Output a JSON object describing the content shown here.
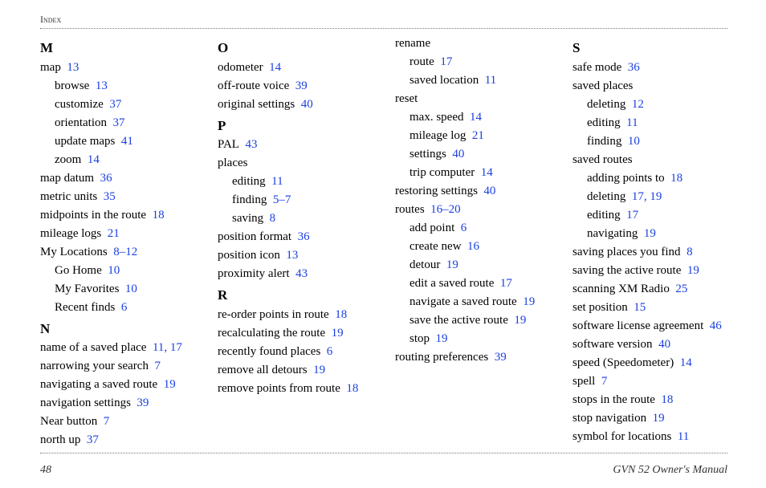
{
  "header": {
    "running_head": "Index"
  },
  "footer": {
    "page_number": "48",
    "doc_title": "GVN 52 Owner's Manual"
  },
  "link_color": "#1a3fe0",
  "columns": [
    [
      {
        "type": "letter",
        "text": "M"
      },
      {
        "type": "entry",
        "level": 0,
        "term": "map",
        "pages": "13"
      },
      {
        "type": "entry",
        "level": 1,
        "term": "browse",
        "pages": "13"
      },
      {
        "type": "entry",
        "level": 1,
        "term": "customize",
        "pages": "37"
      },
      {
        "type": "entry",
        "level": 1,
        "term": "orientation",
        "pages": "37"
      },
      {
        "type": "entry",
        "level": 1,
        "term": "update maps",
        "pages": "41"
      },
      {
        "type": "entry",
        "level": 1,
        "term": "zoom",
        "pages": "14"
      },
      {
        "type": "entry",
        "level": 0,
        "term": "map datum",
        "pages": "36"
      },
      {
        "type": "entry",
        "level": 0,
        "term": "metric units",
        "pages": "35"
      },
      {
        "type": "entry",
        "level": 0,
        "term": "midpoints in the route",
        "pages": "18"
      },
      {
        "type": "entry",
        "level": 0,
        "term": "mileage logs",
        "pages": "21"
      },
      {
        "type": "entry",
        "level": 0,
        "term": "My Locations",
        "pages": "8–12"
      },
      {
        "type": "entry",
        "level": 1,
        "term": "Go Home",
        "pages": "10"
      },
      {
        "type": "entry",
        "level": 1,
        "term": "My Favorites",
        "pages": "10"
      },
      {
        "type": "entry",
        "level": 1,
        "term": "Recent finds",
        "pages": "6"
      },
      {
        "type": "letter",
        "text": "N"
      },
      {
        "type": "entry",
        "level": 0,
        "term": "name of a saved place",
        "pages": "11, 17"
      },
      {
        "type": "entry",
        "level": 0,
        "term": "narrowing your search",
        "pages": "7"
      },
      {
        "type": "entry",
        "level": 0,
        "term": "navigating a saved route",
        "pages": "19"
      },
      {
        "type": "entry",
        "level": 0,
        "term": "navigation settings",
        "pages": "39"
      },
      {
        "type": "entry",
        "level": 0,
        "term": "Near button",
        "pages": "7"
      },
      {
        "type": "entry",
        "level": 0,
        "term": "north up",
        "pages": "37"
      }
    ],
    [
      {
        "type": "letter",
        "text": "O"
      },
      {
        "type": "entry",
        "level": 0,
        "term": "odometer",
        "pages": "14"
      },
      {
        "type": "entry",
        "level": 0,
        "term": "off-route voice",
        "pages": "39"
      },
      {
        "type": "entry",
        "level": 0,
        "term": "original settings",
        "pages": "40"
      },
      {
        "type": "letter",
        "text": "P"
      },
      {
        "type": "entry",
        "level": 0,
        "term": "PAL",
        "pages": "43"
      },
      {
        "type": "entry",
        "level": 0,
        "term": "places",
        "pages": ""
      },
      {
        "type": "entry",
        "level": 1,
        "term": "editing",
        "pages": "11"
      },
      {
        "type": "entry",
        "level": 1,
        "term": "finding",
        "pages": "5–7"
      },
      {
        "type": "entry",
        "level": 1,
        "term": "saving",
        "pages": "8"
      },
      {
        "type": "entry",
        "level": 0,
        "term": "position format",
        "pages": "36"
      },
      {
        "type": "entry",
        "level": 0,
        "term": "position icon",
        "pages": "13"
      },
      {
        "type": "entry",
        "level": 0,
        "term": "proximity alert",
        "pages": "43"
      },
      {
        "type": "letter",
        "text": "R"
      },
      {
        "type": "entry",
        "level": 0,
        "term": "re-order points in route",
        "pages": "18"
      },
      {
        "type": "entry",
        "level": 0,
        "term": "recalculating the route",
        "pages": "19"
      },
      {
        "type": "entry",
        "level": 0,
        "term": "recently found places",
        "pages": "6"
      },
      {
        "type": "entry",
        "level": 0,
        "term": "remove all detours",
        "pages": "19"
      },
      {
        "type": "entry",
        "level": 0,
        "term": "remove points from route",
        "pages": "18"
      }
    ],
    [
      {
        "type": "entry",
        "level": 0,
        "term": "rename",
        "pages": ""
      },
      {
        "type": "entry",
        "level": 1,
        "term": "route",
        "pages": "17"
      },
      {
        "type": "entry",
        "level": 1,
        "term": "saved location",
        "pages": "11"
      },
      {
        "type": "entry",
        "level": 0,
        "term": "reset",
        "pages": ""
      },
      {
        "type": "entry",
        "level": 1,
        "term": "max. speed",
        "pages": "14"
      },
      {
        "type": "entry",
        "level": 1,
        "term": "mileage log",
        "pages": "21"
      },
      {
        "type": "entry",
        "level": 1,
        "term": "settings",
        "pages": "40"
      },
      {
        "type": "entry",
        "level": 1,
        "term": "trip computer",
        "pages": "14"
      },
      {
        "type": "entry",
        "level": 0,
        "term": "restoring settings",
        "pages": "40"
      },
      {
        "type": "entry",
        "level": 0,
        "term": "routes",
        "pages": "16–20"
      },
      {
        "type": "entry",
        "level": 1,
        "term": "add point",
        "pages": "6"
      },
      {
        "type": "entry",
        "level": 1,
        "term": "create new",
        "pages": "16"
      },
      {
        "type": "entry",
        "level": 1,
        "term": "detour",
        "pages": "19"
      },
      {
        "type": "entry",
        "level": 1,
        "term": "edit a saved route",
        "pages": "17"
      },
      {
        "type": "entry",
        "level": 1,
        "term": "navigate a saved route",
        "pages": "19"
      },
      {
        "type": "entry",
        "level": 1,
        "term": "save the active route",
        "pages": "19"
      },
      {
        "type": "entry",
        "level": 1,
        "term": "stop",
        "pages": "19"
      },
      {
        "type": "entry",
        "level": 0,
        "term": "routing preferences",
        "pages": "39"
      }
    ],
    [
      {
        "type": "letter",
        "text": "S"
      },
      {
        "type": "entry",
        "level": 0,
        "term": "safe mode",
        "pages": "36"
      },
      {
        "type": "entry",
        "level": 0,
        "term": "saved places",
        "pages": ""
      },
      {
        "type": "entry",
        "level": 1,
        "term": "deleting",
        "pages": "12"
      },
      {
        "type": "entry",
        "level": 1,
        "term": "editing",
        "pages": "11"
      },
      {
        "type": "entry",
        "level": 1,
        "term": "finding",
        "pages": "10"
      },
      {
        "type": "entry",
        "level": 0,
        "term": "saved routes",
        "pages": ""
      },
      {
        "type": "entry",
        "level": 1,
        "term": "adding points to",
        "pages": "18"
      },
      {
        "type": "entry",
        "level": 1,
        "term": "deleting",
        "pages": "17, 19"
      },
      {
        "type": "entry",
        "level": 1,
        "term": "editing",
        "pages": "17"
      },
      {
        "type": "entry",
        "level": 1,
        "term": "navigating",
        "pages": "19"
      },
      {
        "type": "entry",
        "level": 0,
        "term": "saving places you find",
        "pages": "8"
      },
      {
        "type": "entry",
        "level": 0,
        "term": "saving the active route",
        "pages": "19"
      },
      {
        "type": "entry",
        "level": 0,
        "term": "scanning XM Radio",
        "pages": "25"
      },
      {
        "type": "entry",
        "level": 0,
        "term": "set position",
        "pages": "15"
      },
      {
        "type": "entry",
        "level": 0,
        "term": "software license agreement",
        "pages": "46"
      },
      {
        "type": "entry",
        "level": 0,
        "term": "software version",
        "pages": "40"
      },
      {
        "type": "entry",
        "level": 0,
        "term": "speed (Speedometer)",
        "pages": "14"
      },
      {
        "type": "entry",
        "level": 0,
        "term": "spell",
        "pages": "7"
      },
      {
        "type": "entry",
        "level": 0,
        "term": "stops in the route",
        "pages": "18"
      },
      {
        "type": "entry",
        "level": 0,
        "term": "stop navigation",
        "pages": "19"
      },
      {
        "type": "entry",
        "level": 0,
        "term": "symbol for locations",
        "pages": "11"
      }
    ]
  ]
}
